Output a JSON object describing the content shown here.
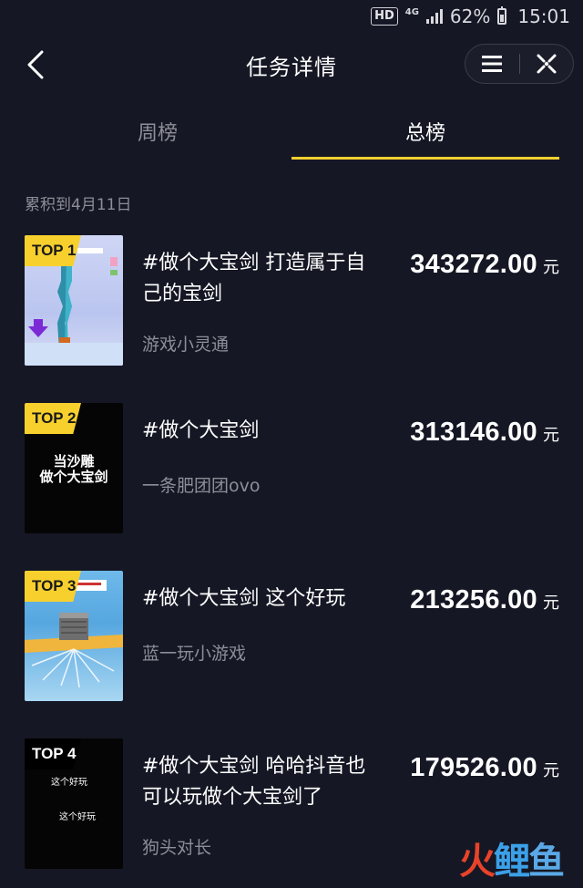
{
  "status_bar": {
    "hd": "HD",
    "network": "4G",
    "battery": "62%",
    "time": "15:01"
  },
  "nav": {
    "title": "任务详情"
  },
  "tabs": [
    {
      "label": "周榜",
      "active": false
    },
    {
      "label": "总榜",
      "active": true
    }
  ],
  "date_note": "累积到4月11日",
  "items": [
    {
      "badge": "TOP 1",
      "title": "#做个大宝剑 打造属于自己的宝剑",
      "author": "游戏小灵通",
      "amount": "343272.00",
      "unit": "元"
    },
    {
      "badge": "TOP 2",
      "title": "#做个大宝剑",
      "author": "一条肥团团ovo",
      "amount": "313146.00",
      "unit": "元",
      "thumb_caption": "当沙雕\n做个大宝剑"
    },
    {
      "badge": "TOP 3",
      "title": "#做个大宝剑 这个好玩",
      "author": "蓝一玩小游戏",
      "amount": "213256.00",
      "unit": "元"
    },
    {
      "badge": "TOP 4",
      "title": "#做个大宝剑 哈哈抖音也可以玩做个大宝剑了",
      "author": "狗头对长",
      "amount": "179526.00",
      "unit": "元",
      "thumb_caption_1": "这个好玩",
      "thumb_caption_2": "这个好玩"
    }
  ],
  "watermark": [
    "火",
    "鲤",
    "鱼"
  ],
  "colors": {
    "background": "#151724",
    "accent": "#f7d02e",
    "muted_text": "#8d8e98"
  }
}
